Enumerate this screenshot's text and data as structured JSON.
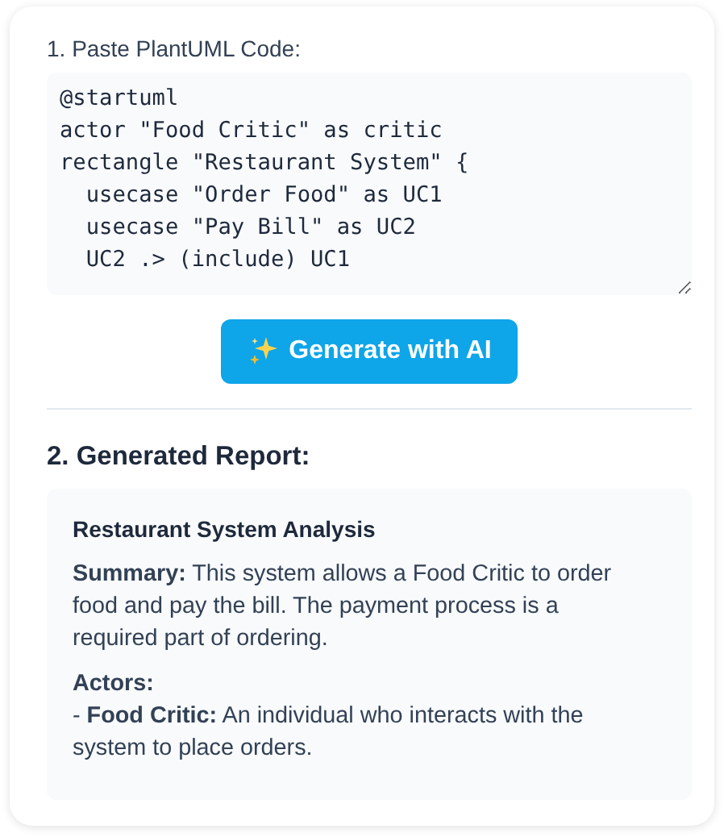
{
  "input": {
    "label": "1. Paste PlantUML Code:",
    "code": [
      "@startuml",
      "actor \"Food Critic\" as critic",
      "rectangle \"Restaurant System\" {",
      "  usecase \"Order Food\" as UC1",
      "  usecase \"Pay Bill\" as UC2",
      "  UC2 .> (include) UC1"
    ]
  },
  "generate_button": {
    "label": "Generate with AI"
  },
  "report": {
    "heading": "2. Generated Report:",
    "title": "Restaurant System Analysis",
    "sections": [
      {
        "kind": "paragraph",
        "text": "**Summary:** This system allows a Food Critic to order food and pay the bill. The payment process is a required part of ordering."
      },
      {
        "kind": "heading",
        "text": "Actors:"
      },
      {
        "kind": "item",
        "text": "- **Food Critic:** An individual who interacts with the system to place orders."
      }
    ]
  }
}
